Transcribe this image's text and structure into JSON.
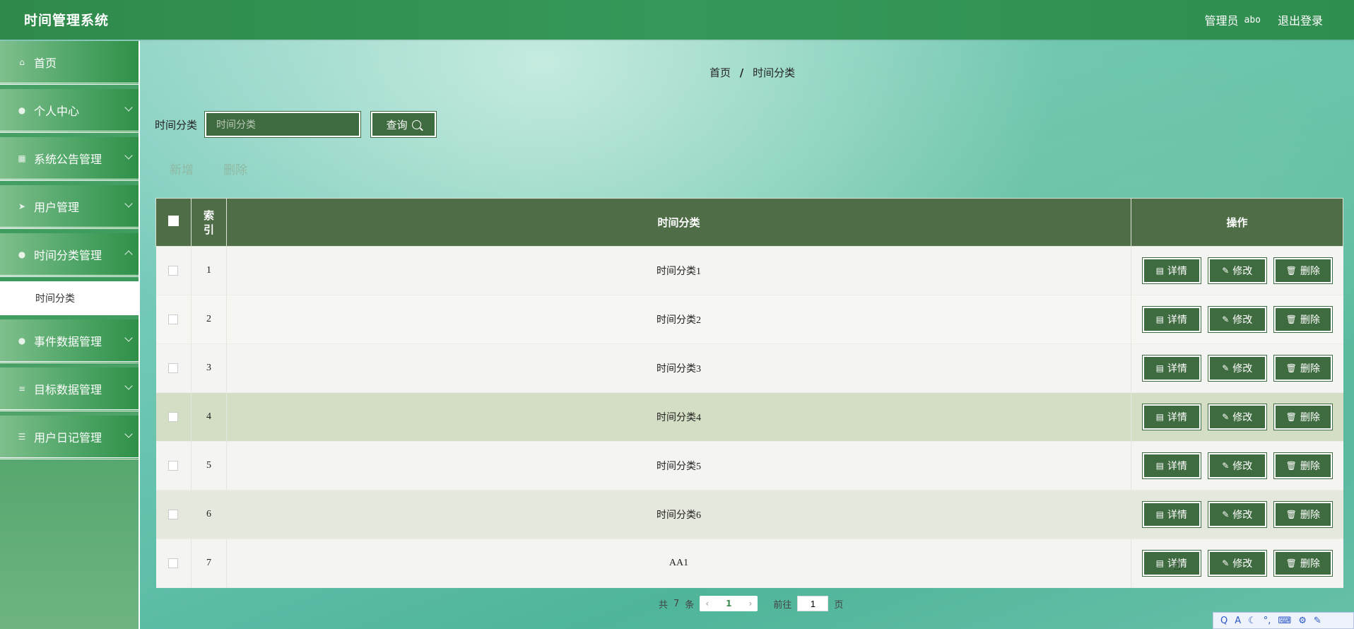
{
  "app": {
    "title": "时间管理系统"
  },
  "header": {
    "role": "管理员",
    "username": "abo",
    "logout": "退出登录"
  },
  "sidebar": {
    "items": [
      {
        "label": "首页",
        "icon": "home-icon",
        "glyph": "⌂"
      },
      {
        "label": "个人中心",
        "icon": "user-icon",
        "glyph": "●"
      },
      {
        "label": "系统公告管理",
        "icon": "grid-icon",
        "glyph": "▦"
      },
      {
        "label": "用户管理",
        "icon": "send-icon",
        "glyph": "➤"
      },
      {
        "label": "时间分类管理",
        "icon": "location-icon",
        "glyph": "●"
      },
      {
        "label": "时间分类",
        "sub": true
      },
      {
        "label": "事件数据管理",
        "icon": "user-icon",
        "glyph": "●"
      },
      {
        "label": "目标数据管理",
        "icon": "menu-icon",
        "glyph": "≡"
      },
      {
        "label": "用户日记管理",
        "icon": "sliders-icon",
        "glyph": "☰"
      }
    ]
  },
  "breadcrumb": {
    "home": "首页",
    "sep": "/",
    "current": "时间分类"
  },
  "search": {
    "label": "时间分类",
    "placeholder": "时间分类",
    "button": "查询"
  },
  "actions": {
    "add": "新增",
    "delete": "删除"
  },
  "table": {
    "headers": {
      "index": "索引",
      "name": "时间分类",
      "ops": "操作"
    },
    "rows": [
      {
        "index": "1",
        "name": "时间分类1"
      },
      {
        "index": "2",
        "name": "时间分类2"
      },
      {
        "index": "3",
        "name": "时间分类3"
      },
      {
        "index": "4",
        "name": "时间分类4"
      },
      {
        "index": "5",
        "name": "时间分类5"
      },
      {
        "index": "6",
        "name": "时间分类6"
      },
      {
        "index": "7",
        "name": "AA1"
      }
    ],
    "op_labels": {
      "detail": "详情",
      "edit": "修改",
      "delete": "删除"
    }
  },
  "pagination": {
    "total_prefix": "共",
    "total": "7",
    "total_suffix": "条",
    "current": "1",
    "goto_prefix": "前往",
    "goto_value": "1",
    "goto_suffix": "页"
  },
  "ime": {
    "glyphs": [
      "Q",
      "A",
      "☾",
      "°,",
      "⌨",
      "⚙",
      "✎"
    ]
  },
  "colors": {
    "header": "#2f8a4a",
    "table_head": "#4f6d47",
    "button": "#3f6b40",
    "highlight_row": "#d4dec4"
  }
}
